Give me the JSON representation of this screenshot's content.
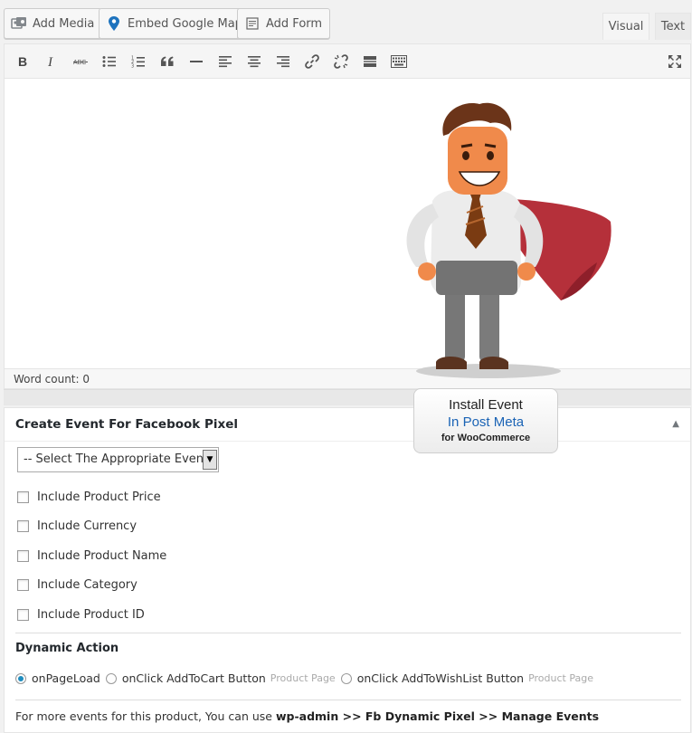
{
  "media_bar": {
    "add_media": "Add Media",
    "embed_map": "Embed Google Map",
    "add_form": "Add Form"
  },
  "tabs": {
    "visual": "Visual",
    "text": "Text"
  },
  "toolbar_icons": [
    "bold-icon",
    "italic-icon",
    "strikethrough-icon",
    "bullet-list-icon",
    "numbered-list-icon",
    "blockquote-icon",
    "horizontal-rule-icon",
    "align-left-icon",
    "align-center-icon",
    "align-right-icon",
    "link-icon",
    "unlink-icon",
    "read-more-icon",
    "toolbar-toggle-icon",
    "fullscreen-icon"
  ],
  "toolbar_glyphs": {
    "strike": "ABC"
  },
  "editor": {
    "word_count": "Word count: 0"
  },
  "promo": {
    "line1": "Install Event",
    "line2": "In Post Meta",
    "line3": "for WooCommerce"
  },
  "metabox": {
    "title": "Create Event For Facebook Pixel",
    "toggle": "▲",
    "select_value": "-- Select The Appropriate Event",
    "checkboxes": [
      "Include Product Price",
      "Include Currency",
      "Include Product Name",
      "Include Category",
      "Include Product ID"
    ],
    "dynamic_title": "Dynamic Action",
    "radios": [
      {
        "label": "onPageLoad",
        "hint": "",
        "checked": true
      },
      {
        "label": "onClick AddToCart Button",
        "hint": "Product Page",
        "checked": false
      },
      {
        "label": "onClick AddToWishList Button",
        "hint": "Product Page",
        "checked": false
      }
    ],
    "footer": {
      "prefix": "For more events for this product, You can use ",
      "bold": "wp-admin >> Fb Dynamic Pixel >> Manage Events"
    }
  },
  "colors": {
    "accent": "#1e8cbe",
    "promo_blue": "#1a63b5",
    "cape": "#b5303a"
  }
}
